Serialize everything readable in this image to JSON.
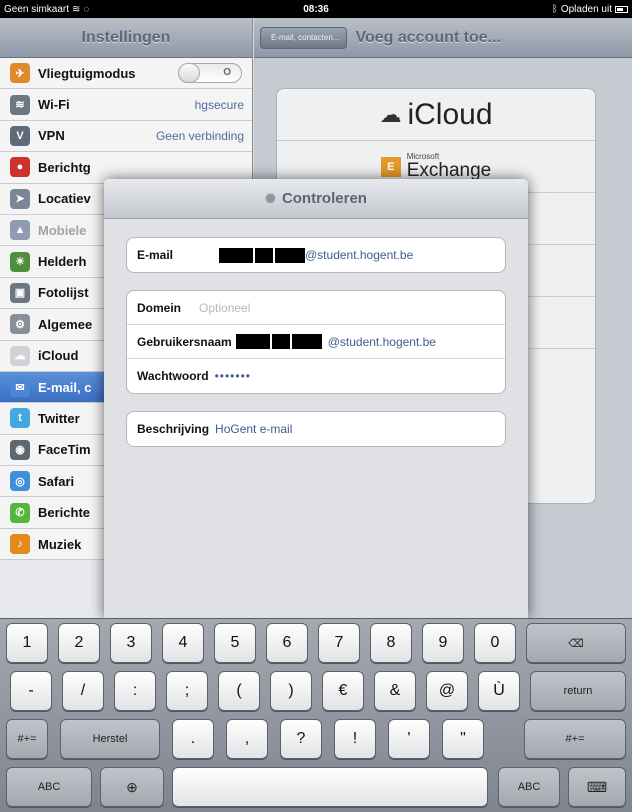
{
  "status_bar": {
    "carrier": "Geen simkaart",
    "time": "08:36",
    "battery_text": "Opladen uit"
  },
  "master": {
    "title": "Instellingen",
    "items": [
      {
        "label": "Vliegtuigmodus",
        "value": "",
        "toggle": "O",
        "icon": "airplane-icon",
        "color": "#e0892a"
      },
      {
        "label": "Wi-Fi",
        "value": "hgsecure",
        "icon": "wifi-icon",
        "color": "#6c7784"
      },
      {
        "label": "VPN",
        "value": "Geen verbinding",
        "icon": "vpn-icon",
        "color": "#5f6b78"
      },
      {
        "label": "Berichtg",
        "value": "",
        "icon": "notifications-icon",
        "color": "#d0312d"
      },
      {
        "label": "Locatiev",
        "value": "",
        "icon": "location-icon",
        "color": "#7b8796"
      },
      {
        "label": "Mobiele",
        "value": "",
        "icon": "cellular-icon",
        "color": "#8f9bb0",
        "dim": true
      },
      {
        "label": "Helderh",
        "value": "",
        "icon": "brightness-icon",
        "color": "#4e8f3e"
      },
      {
        "label": "Fotolijst",
        "value": "",
        "icon": "picture-frame-icon",
        "color": "#6d7783"
      },
      {
        "label": "Algemee",
        "value": "",
        "icon": "gear-icon",
        "color": "#8a9099"
      },
      {
        "label": "iCloud",
        "value": "",
        "icon": "icloud-icon",
        "color": "#cfd3d8"
      },
      {
        "label": "E-mail, c",
        "value": "",
        "icon": "mail-icon",
        "color": "#4d86d2",
        "active": true
      },
      {
        "label": "Twitter",
        "value": "",
        "icon": "twitter-icon",
        "color": "#3fa9e0"
      },
      {
        "label": "FaceTim",
        "value": "",
        "icon": "facetime-icon",
        "color": "#5e6670"
      },
      {
        "label": "Safari",
        "value": "",
        "icon": "safari-icon",
        "color": "#3f8fd8"
      },
      {
        "label": "Berichte",
        "value": "",
        "icon": "messages-icon",
        "color": "#55b63f"
      },
      {
        "label": "Muziek",
        "value": "",
        "icon": "music-icon",
        "color": "#e38a1e"
      }
    ]
  },
  "detail": {
    "back_label": "E-mail, contacten...",
    "title": "Voeg account toe...",
    "providers": [
      {
        "name": "iCloud"
      },
      {
        "brand": "Microsoft",
        "name": "Exchange"
      }
    ]
  },
  "sheet": {
    "title": "Controleren",
    "email": {
      "label": "E-mail",
      "value": "@student.hogent.be"
    },
    "domain": {
      "label": "Domein",
      "placeholder": "Optioneel"
    },
    "username": {
      "label": "Gebruikersnaam",
      "value": "@student.hogent.be"
    },
    "password": {
      "label": "Wachtwoord",
      "value": "•••••••"
    },
    "description": {
      "label": "Beschrijving",
      "value": "HoGent e-mail"
    }
  },
  "keyboard": {
    "rows": [
      [
        "1",
        "2",
        "3",
        "4",
        "5",
        "6",
        "7",
        "8",
        "9",
        "0",
        "⌫"
      ],
      [
        "-",
        "/",
        ":",
        ";",
        "(",
        ")",
        "€",
        "&",
        "@",
        "Ù",
        "return"
      ],
      [
        "#+=",
        "Herstel",
        ".",
        ",",
        "?",
        "!",
        "'",
        "\"",
        "#+="
      ],
      [
        "ABC",
        "globe",
        "",
        "ABC",
        "keyboard"
      ]
    ]
  }
}
